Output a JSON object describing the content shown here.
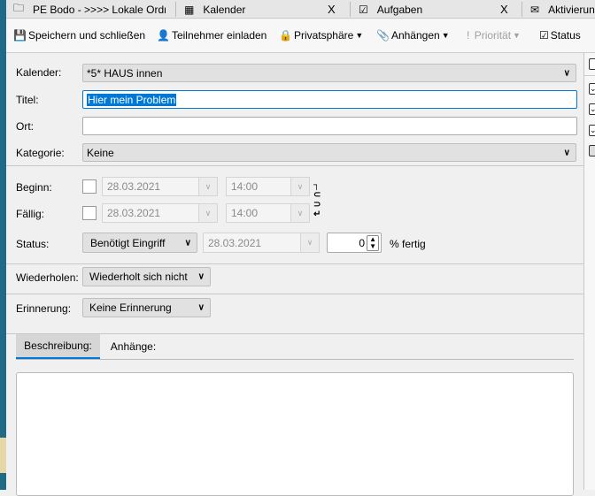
{
  "tabs": [
    {
      "label": "PE Bodo - >>>> Lokale Ordn",
      "icon": "folder-icon"
    },
    {
      "label": "Kalender",
      "icon": "calendar-icon",
      "close": "X"
    },
    {
      "label": "Aufgaben",
      "icon": "tasks-icon",
      "close": "X"
    },
    {
      "label": "Aktivierung",
      "icon": "mail-icon"
    }
  ],
  "toolbar": {
    "save_close": "Speichern und schließen",
    "invite": "Teilnehmer einladen",
    "privacy": "Privatsphäre",
    "attach": "Anhängen",
    "priority": "Priorität",
    "status": "Status"
  },
  "form": {
    "calendar_label": "Kalender:",
    "calendar_value": "*5* HAUS innen",
    "title_label": "Titel:",
    "title_value": "Hier mein Problem",
    "location_label": "Ort:",
    "location_value": "",
    "category_label": "Kategorie:",
    "category_value": "Keine",
    "start_label": "Beginn:",
    "start_date": "28.03.2021",
    "start_time": "14:00",
    "due_label": "Fällig:",
    "due_date": "28.03.2021",
    "due_time": "14:00",
    "status_label": "Status:",
    "status_value": "Benötigt Eingriff",
    "status_date": "28.03.2021",
    "percent_value": "0",
    "percent_label": "% fertig",
    "repeat_label": "Wiederholen:",
    "repeat_value": "Wiederholt sich nicht",
    "reminder_label": "Erinnerung:",
    "reminder_value": "Keine Erinnerung"
  },
  "bottom_tabs": {
    "description": "Beschreibung:",
    "attachments": "Anhänge:"
  },
  "colors": {
    "accent": "#0078d7",
    "selection": "#0078d7"
  }
}
